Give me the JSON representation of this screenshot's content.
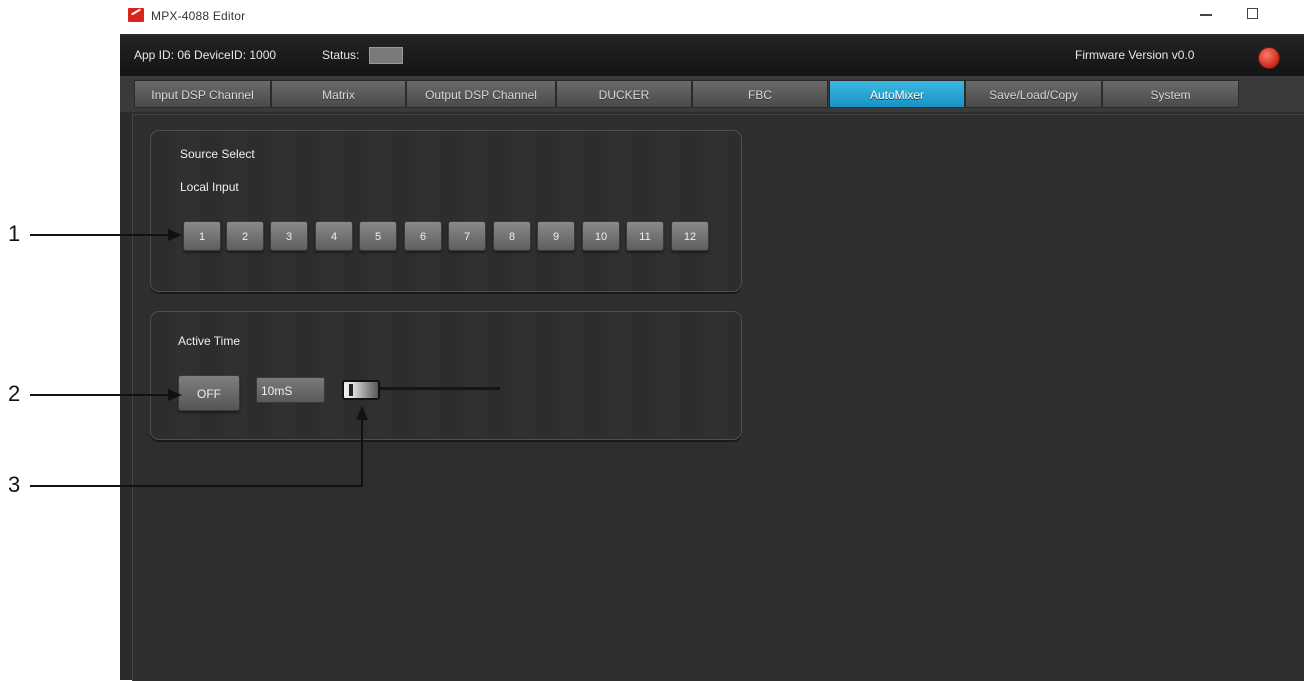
{
  "window": {
    "title": "MPX-4088 Editor",
    "minimize_glyph": "minimize-icon",
    "maximize_glyph": "maximize-icon"
  },
  "infobar": {
    "app_device": "App ID: 06  DeviceID: 1000",
    "status_label": "Status:",
    "firmware": "Firmware Version v0.0",
    "close_icon": "close-icon"
  },
  "tabs": [
    {
      "label": "Input DSP Channel"
    },
    {
      "label": "Matrix"
    },
    {
      "label": "Output DSP Channel"
    },
    {
      "label": "DUCKER"
    },
    {
      "label": "FBC"
    },
    {
      "label": "AutoMixer",
      "active": true
    },
    {
      "label": "Save/Load/Copy"
    },
    {
      "label": "System"
    }
  ],
  "source_select": {
    "title": "Source Select",
    "subtitle": "Local Input",
    "channels": [
      "1",
      "2",
      "3",
      "4",
      "5",
      "6",
      "7",
      "8",
      "9",
      "10",
      "11",
      "12"
    ]
  },
  "active_time": {
    "title": "Active Time",
    "off_label": "OFF",
    "value": "10mS",
    "slider_level": 0
  },
  "callouts": [
    "1",
    "2",
    "3"
  ],
  "colors": {
    "active_tab": "#1a93c4",
    "background": "#2e2e2e",
    "close_button": "#c8291b",
    "logo": "#d8241c"
  }
}
